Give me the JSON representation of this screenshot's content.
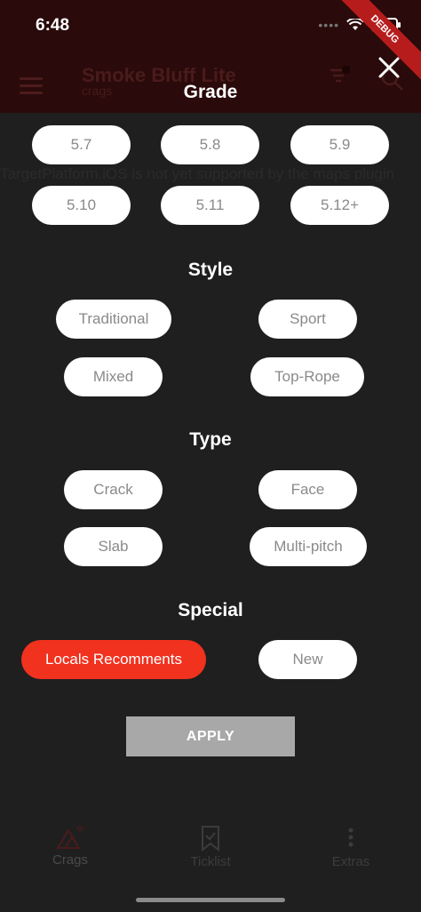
{
  "status": {
    "time": "6:48"
  },
  "debug_label": "DEBUG",
  "app": {
    "title": "Smoke Bluff Lite",
    "subtitle": "crags",
    "maps_warning": "TargetPlatform.iOS is not yet supported by the maps plugin"
  },
  "filters": {
    "grade": {
      "title": "Grade",
      "options": [
        "5.7",
        "5.8",
        "5.9",
        "5.10",
        "5.11",
        "5.12+"
      ]
    },
    "style": {
      "title": "Style",
      "options": [
        "Traditional",
        "Sport",
        "Mixed",
        "Top-Rope"
      ]
    },
    "type": {
      "title": "Type",
      "options": [
        "Crack",
        "Face",
        "Slab",
        "Multi-pitch"
      ]
    },
    "special": {
      "title": "Special",
      "options": [
        "Locals Recomments",
        "New"
      ],
      "selected": "Locals Recomments"
    },
    "apply_label": "APPLY"
  },
  "tabs": [
    {
      "label": "Crags",
      "icon": "mountain-icon"
    },
    {
      "label": "Ticklist",
      "icon": "bookmark-icon"
    },
    {
      "label": "Extras",
      "icon": "more-vert-icon"
    }
  ],
  "colors": {
    "accent": "#f0321f",
    "background": "#1f1f1f",
    "appbar_dim": "#2a0a0a",
    "apply": "#a8a8a8"
  }
}
